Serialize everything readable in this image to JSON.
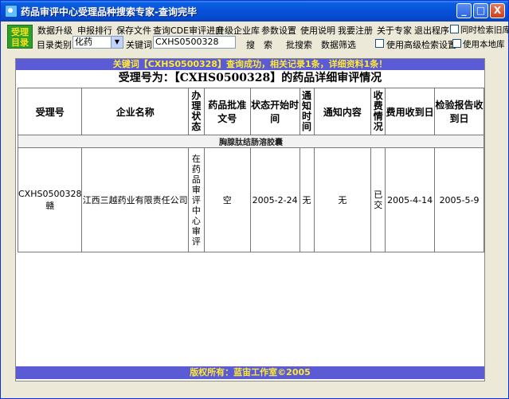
{
  "window": {
    "title": "药品审评中心受理品种搜索专家-查询完毕",
    "min": "_",
    "max": "□",
    "close": "X"
  },
  "logo": {
    "line1": "受理",
    "line2": "目录"
  },
  "menu": [
    {
      "label": "数据升级"
    },
    {
      "label": "申报排行"
    },
    {
      "label": "保存文件"
    },
    {
      "label": "查询CDE审评进度"
    },
    {
      "label": "升级企业库"
    },
    {
      "label": "参数设置"
    },
    {
      "label": "使用说明"
    },
    {
      "label": "我要注册"
    },
    {
      "label": "关于专家"
    },
    {
      "label": "退出程序"
    },
    {
      "label": "同时检索旧库"
    }
  ],
  "toolbar": {
    "catalog_label": "目录类别",
    "catalog_value": "化药",
    "keyword_label": "关键词",
    "keyword_value": "CXHS0500328",
    "search_button": "搜　索",
    "batch_search": "批搜索",
    "filter": "数据筛选",
    "advanced_label": "使用高级检索设置",
    "local_label": "使用本地库"
  },
  "result": {
    "notice": "关键词【CXHS0500328】查询成功，相关记录1条，详细资料1条！",
    "heading": "受理号为：【CXHS0500328】的药品详细审评情况",
    "footer": "版权所有：蓝宙工作室©2005"
  },
  "table": {
    "headers": [
      "受理号",
      "企业名称",
      "办理状态",
      "药品批准文号",
      "状态开始时间",
      "通知时间",
      "通知内容",
      "收费情况",
      "费用收到日",
      "检验报告收到日"
    ],
    "drug_name": "胸腺肽结肠溶胶囊",
    "row": {
      "accept_no": "CXHS0500328赣",
      "company": "江西三越药业有限责任公司",
      "status": "在药品审评中心审评",
      "approval_no": "空",
      "status_start": "2005-2-24",
      "notice_time": "无",
      "notice_content": "无",
      "fee": "已交",
      "fee_date": "2005-4-14",
      "report_date": "2005-5-9"
    }
  }
}
